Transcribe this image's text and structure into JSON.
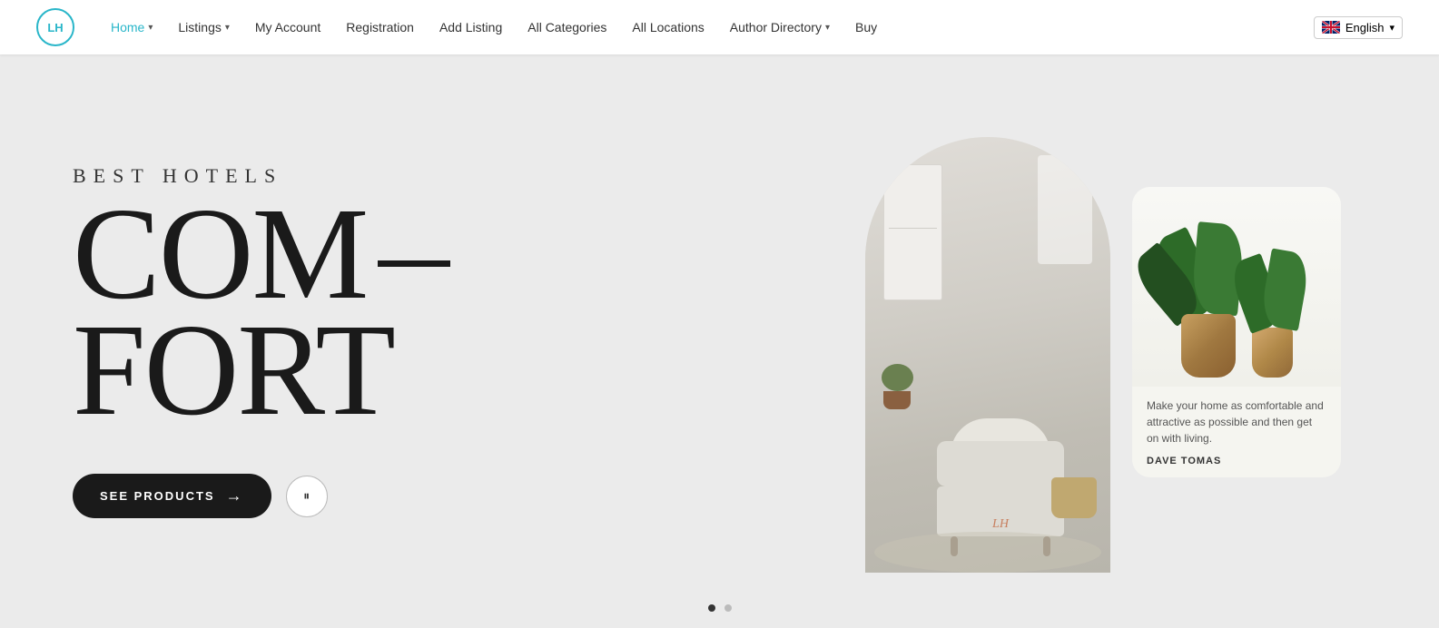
{
  "header": {
    "logo_text": "LH",
    "nav": [
      {
        "label": "Home",
        "has_chevron": true,
        "active": true,
        "key": "home"
      },
      {
        "label": "Listings",
        "has_chevron": true,
        "active": false,
        "key": "listings"
      },
      {
        "label": "My Account",
        "has_chevron": false,
        "active": false,
        "key": "my-account"
      },
      {
        "label": "Registration",
        "has_chevron": false,
        "active": false,
        "key": "registration"
      },
      {
        "label": "Add Listing",
        "has_chevron": false,
        "active": false,
        "key": "add-listing"
      },
      {
        "label": "All Categories",
        "has_chevron": false,
        "active": false,
        "key": "all-categories"
      },
      {
        "label": "All Locations",
        "has_chevron": false,
        "active": false,
        "key": "all-locations"
      },
      {
        "label": "Author Directory",
        "has_chevron": true,
        "active": false,
        "key": "author-directory"
      },
      {
        "label": "Buy",
        "has_chevron": false,
        "active": false,
        "key": "buy"
      }
    ],
    "language": {
      "label": "English",
      "chevron": "▼"
    }
  },
  "hero": {
    "subtitle": "BEST HOTELS",
    "heading_line1": "COM—",
    "heading_line2": "FORT",
    "cta_button": "SEE PRODUCTS",
    "arrow": "→",
    "pause_icon": "⏸",
    "dots": [
      {
        "active": true
      },
      {
        "active": false
      }
    ]
  },
  "side_card": {
    "quote": "Make your home as comfortable and attractive as possible and then get on with living.",
    "author": "DAVE TOMAS"
  }
}
